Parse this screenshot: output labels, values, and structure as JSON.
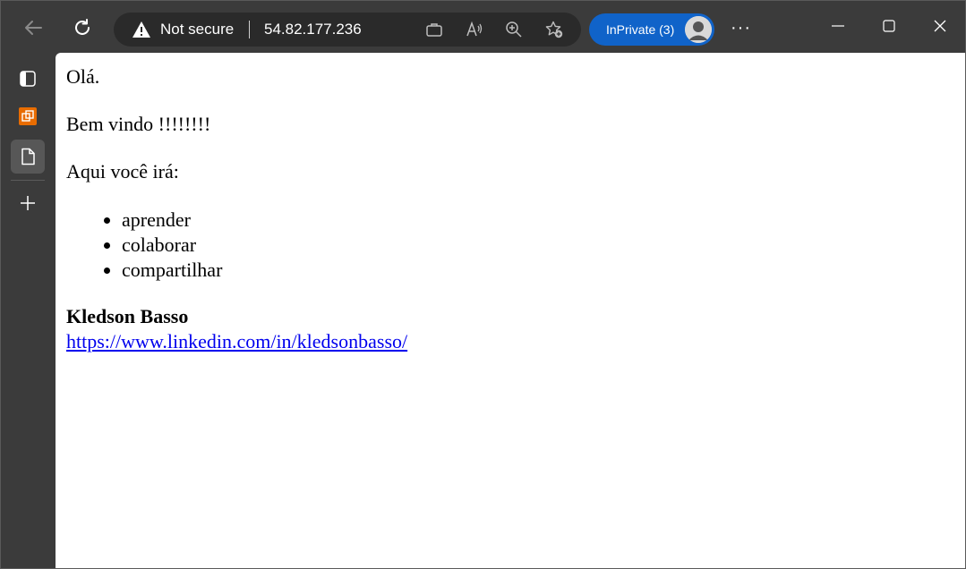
{
  "browser": {
    "address": {
      "security_label": "Not secure",
      "url": "54.82.177.236"
    },
    "inprivate_label": "InPrivate (3)",
    "more_label": "···"
  },
  "page": {
    "greeting": "Olá.",
    "welcome": "Bem vindo !!!!!!!!",
    "intro": "Aqui você irá:",
    "items": [
      "aprender",
      "colaborar",
      "compartilhar"
    ],
    "author_name": "Kledson Basso",
    "author_link": "https://www.linkedin.com/in/kledsonbasso/"
  },
  "colors": {
    "chrome_bg": "#3b3b3b",
    "addressbar_bg": "#2a2a2a",
    "inprivate_bg": "#1063c9",
    "link": "#0000ee"
  }
}
